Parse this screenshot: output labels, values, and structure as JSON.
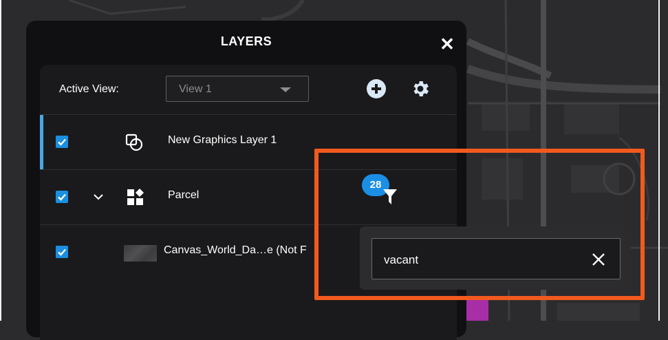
{
  "panel": {
    "title": "LAYERS",
    "close_icon": "close-icon"
  },
  "toolbar": {
    "active_view_label": "Active View:",
    "view_select_value": "View 1",
    "add_icon": "plus-circle-icon",
    "settings_icon": "gear-icon"
  },
  "layers": [
    {
      "name": "New Graphics Layer 1",
      "checked": true,
      "selected": true,
      "icon": "graphics-layer-icon"
    },
    {
      "name": "Parcel",
      "checked": true,
      "expandable": true,
      "icon": "feature-layer-icon"
    },
    {
      "name": "Canvas_World_Da…e (Not F",
      "checked": true,
      "icon": "basemap-thumbnail"
    }
  ],
  "filter": {
    "count_badge": "28",
    "icon": "filter-icon",
    "search_value": "vacant",
    "clear_icon": "close-icon"
  },
  "colors": {
    "accent": "#1a8fe0",
    "selection_bar": "#4aa8e2",
    "highlight_border": "#f25a1d",
    "panel_bg": "#101012"
  }
}
